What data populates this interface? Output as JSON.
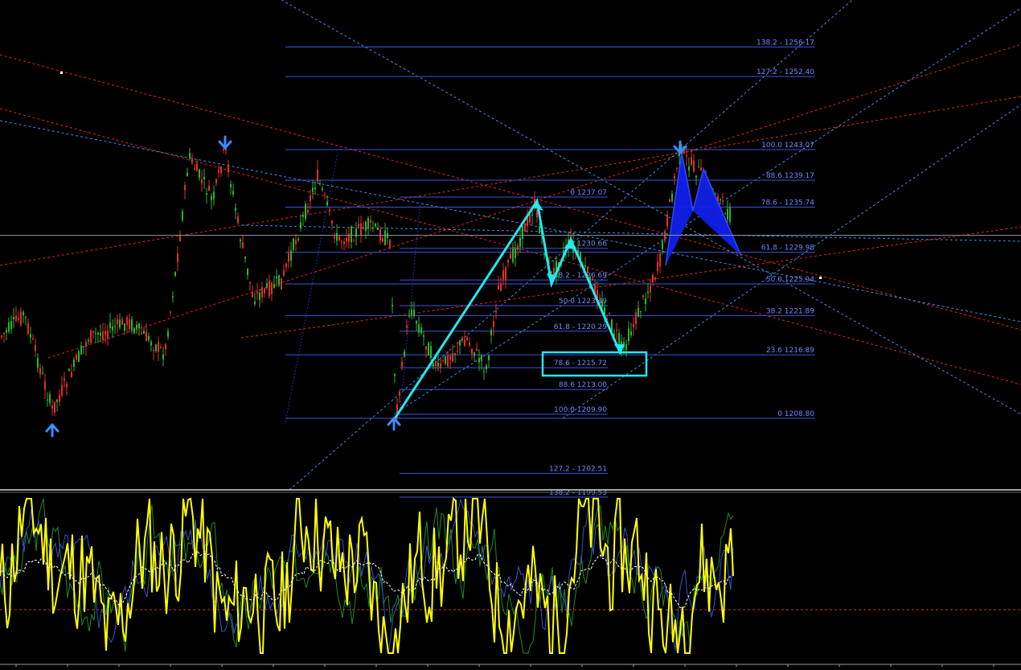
{
  "chart_data": [
    {
      "type": "line",
      "panel": "price",
      "colors": {
        "background": "#000000",
        "bull_candle": "#2db52d",
        "bear_candle": "#e0312a",
        "fib_line": "#3a55d9",
        "fib_label": "#6f86ff",
        "trend_red": "#e0251e",
        "trend_blue": "#3f8be8",
        "pattern_cyan": "#22e8f0",
        "pattern_fill": "#1020e8",
        "arrow": "#3d8bff",
        "crosshair": "#8a8fa3"
      },
      "fib_levels_right": [
        {
          "label": "138.2 - 1256.17"
        },
        {
          "label": "127.2 - 1252.40"
        },
        {
          "label": "100.0 1243.07"
        },
        {
          "label": "88.6 1239.17"
        },
        {
          "label": "78.6 - 1235.74"
        },
        {
          "label": "61.8 - 1229.98"
        },
        {
          "label": "50.0 1225.94"
        },
        {
          "label": "38.2 1221.89"
        },
        {
          "label": "23.6 1216.89"
        },
        {
          "label": "0 1208.80"
        }
      ],
      "fib_levels_mid": [
        {
          "label": "0 1237.07"
        },
        {
          "label": "1230.66"
        },
        {
          "label": "38.2 - 1226.69"
        },
        {
          "label": "50.0 1223.49"
        },
        {
          "label": "61.8 - 1220.29"
        },
        {
          "label": "78.6 - 1215.72"
        },
        {
          "label": "88.6 1213.00"
        },
        {
          "label": "100.0 1209.90"
        },
        {
          "label": "127.2 - 1202.51"
        },
        {
          "label": "138.2 - 1199.53"
        }
      ],
      "swing_markers": [
        {
          "kind": "low",
          "price": 1208.8
        },
        {
          "kind": "high",
          "price": 1243.07
        },
        {
          "kind": "low",
          "price": 1209.9
        },
        {
          "kind": "high",
          "price": 1243.07
        }
      ]
    },
    {
      "type": "line",
      "panel": "oscillator",
      "series": [
        {
          "color": "#ffff00"
        },
        {
          "color": "#3a4fd0"
        },
        {
          "color": "#1f8a2a"
        },
        {
          "color": "#ffffff"
        }
      ],
      "reference_level_color": "#c0304a"
    }
  ]
}
